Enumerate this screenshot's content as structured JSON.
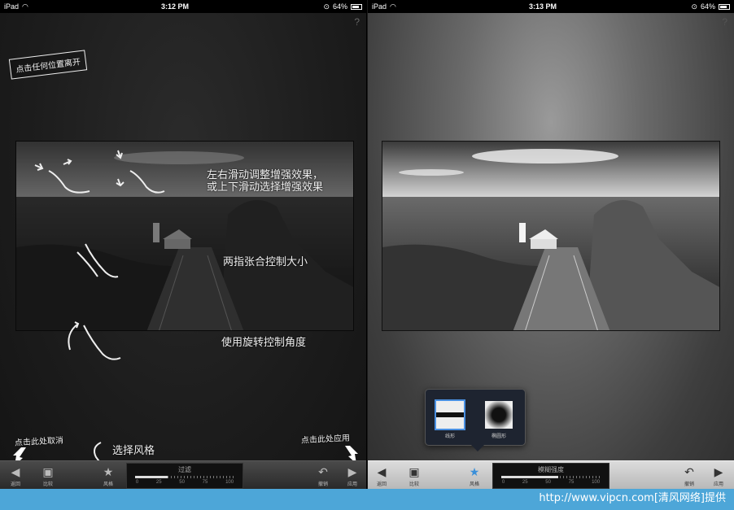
{
  "left": {
    "status": {
      "carrier": "iPad",
      "time": "3:12 PM",
      "battery": "64%"
    },
    "help": "?",
    "hint_badge": "点击任何位置离开",
    "hint_swipe_1": "左右滑动调整增强效果，",
    "hint_swipe_2": "或上下滑动选择增强效果",
    "hint_pinch": "两指张合控制大小",
    "hint_rotate": "使用旋转控制角度",
    "cancel_hint": "点击此处取消",
    "style_hint": "选择风格",
    "apply_hint": "点击此处应用",
    "toolbar": {
      "back": "返回",
      "compare": "比较",
      "style": "风格",
      "slider_title": "过滤",
      "slider_ticks": [
        "0",
        "25",
        "50",
        "75",
        "100"
      ],
      "undo": "撤销",
      "apply": "应用"
    }
  },
  "right": {
    "status": {
      "carrier": "iPad",
      "time": "3:13 PM",
      "battery": "64%"
    },
    "help": "?",
    "popover": {
      "option_1": "线形",
      "option_2": "椭圆形"
    },
    "toolbar": {
      "back": "返回",
      "compare": "比较",
      "style": "风格",
      "slider_title": "模糊强度",
      "slider_ticks": [
        "0",
        "25",
        "50",
        "75",
        "100"
      ],
      "undo": "撤销",
      "apply": "应用"
    }
  },
  "footer": "http://www.vipcn.com[清风网络]提供"
}
